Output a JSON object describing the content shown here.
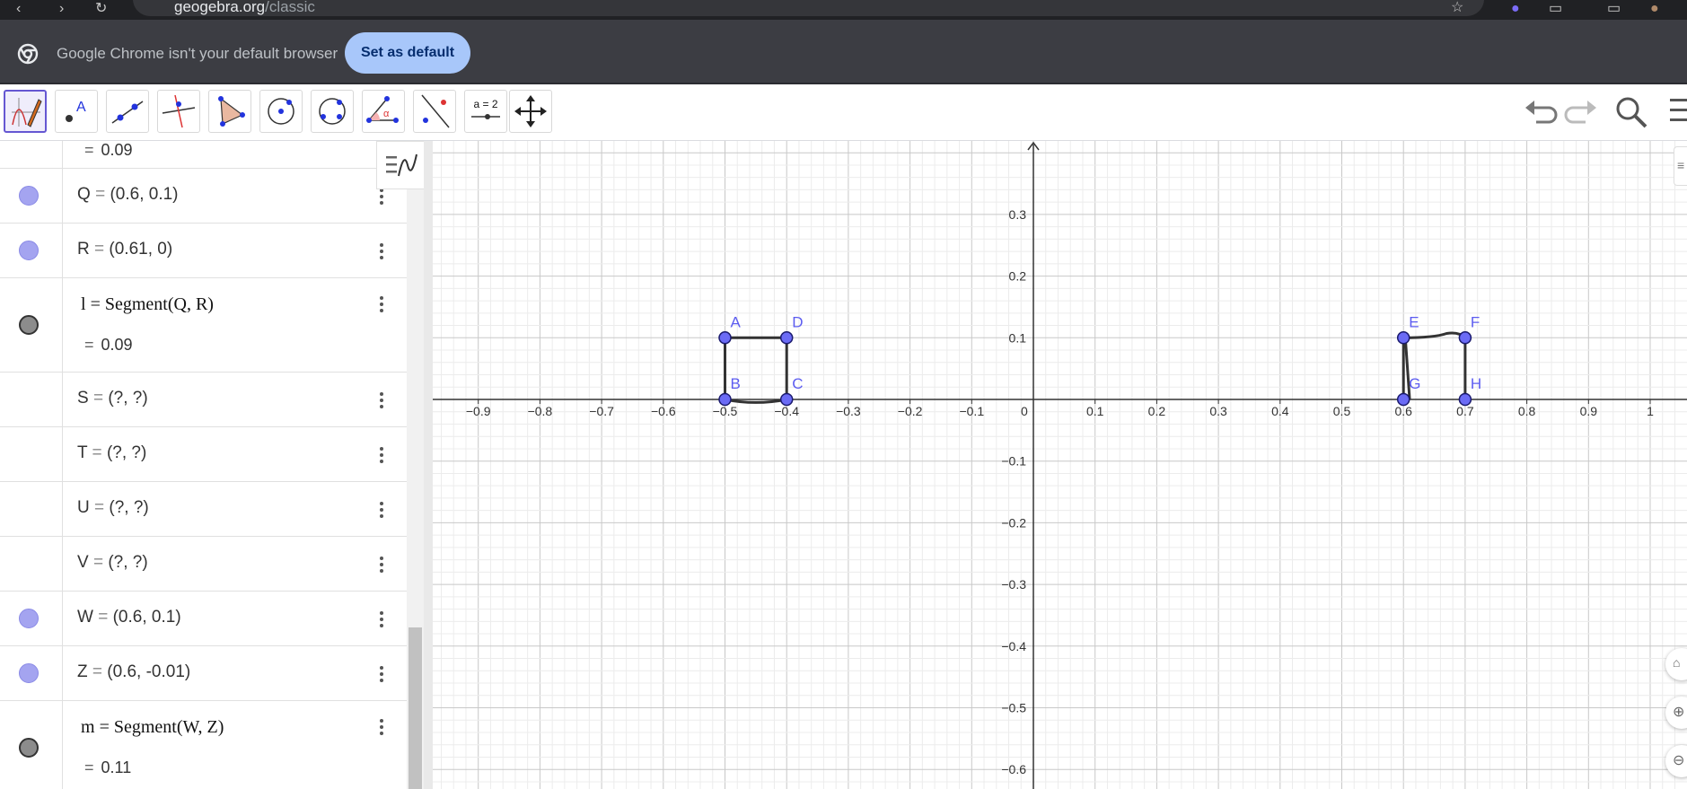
{
  "browser": {
    "url_host": "geogebra.org",
    "url_path": "/classic"
  },
  "infobar": {
    "message": "Google Chrome isn't your default browser",
    "button_label": "Set as default"
  },
  "toolbar": {
    "tools": [
      "function-tool",
      "point-tool",
      "line-tool",
      "perpendicular-tool",
      "polygon-tool",
      "circle-center-tool",
      "circle-three-points-tool",
      "angle-tool",
      "reflect-tool",
      "slider-tool",
      "move-graphics-tool"
    ],
    "slider_label": "a = 2"
  },
  "algebra": {
    "top_value": "0.09",
    "rows": [
      {
        "name": "Q",
        "value": "(0.6, 0.1)"
      },
      {
        "name": "R",
        "value": "(0.61, 0)"
      },
      {
        "name": "l",
        "definition": "Segment(Q, R)",
        "value": "0.09"
      },
      {
        "name": "S",
        "value": "(?, ?)"
      },
      {
        "name": "T",
        "value": "(?, ?)"
      },
      {
        "name": "U",
        "value": "(?, ?)"
      },
      {
        "name": "V",
        "value": "(?, ?)"
      },
      {
        "name": "W",
        "value": "(0.6, 0.1)"
      },
      {
        "name": "Z",
        "value": "(0.6, -0.01)"
      },
      {
        "name": "m",
        "definition": "Segment(W, Z)",
        "value": "0.11"
      }
    ]
  },
  "graphics": {
    "x_ticks": [
      "−0.9",
      "−0.8",
      "−0.7",
      "−0.6",
      "−0.5",
      "−0.4",
      "−0.3",
      "−0.2",
      "−0.1",
      "0",
      "0.1",
      "0.2",
      "0.3",
      "0.4",
      "0.5",
      "0.6",
      "0.7",
      "0.8",
      "0.9",
      "1"
    ],
    "y_ticks_pos": [
      "0.3",
      "0.2",
      "0.1"
    ],
    "y_ticks_neg": [
      "−0.1",
      "−0.2",
      "−0.3",
      "−0.4",
      "−0.5",
      "−0.6"
    ],
    "points": [
      {
        "label": "A",
        "x": -0.5,
        "y": 0.1
      },
      {
        "label": "D",
        "x": -0.4,
        "y": 0.1
      },
      {
        "label": "B",
        "x": -0.5,
        "y": 0
      },
      {
        "label": "C",
        "x": -0.4,
        "y": 0
      },
      {
        "label": "E",
        "x": 0.6,
        "y": 0.1
      },
      {
        "label": "F",
        "x": 0.7,
        "y": 0.1
      },
      {
        "label": "G",
        "x": 0.6,
        "y": 0
      },
      {
        "label": "H",
        "x": 0.7,
        "y": 0
      }
    ],
    "point_color": "#5c5cf0",
    "point_fill": "#6b6bf5"
  }
}
